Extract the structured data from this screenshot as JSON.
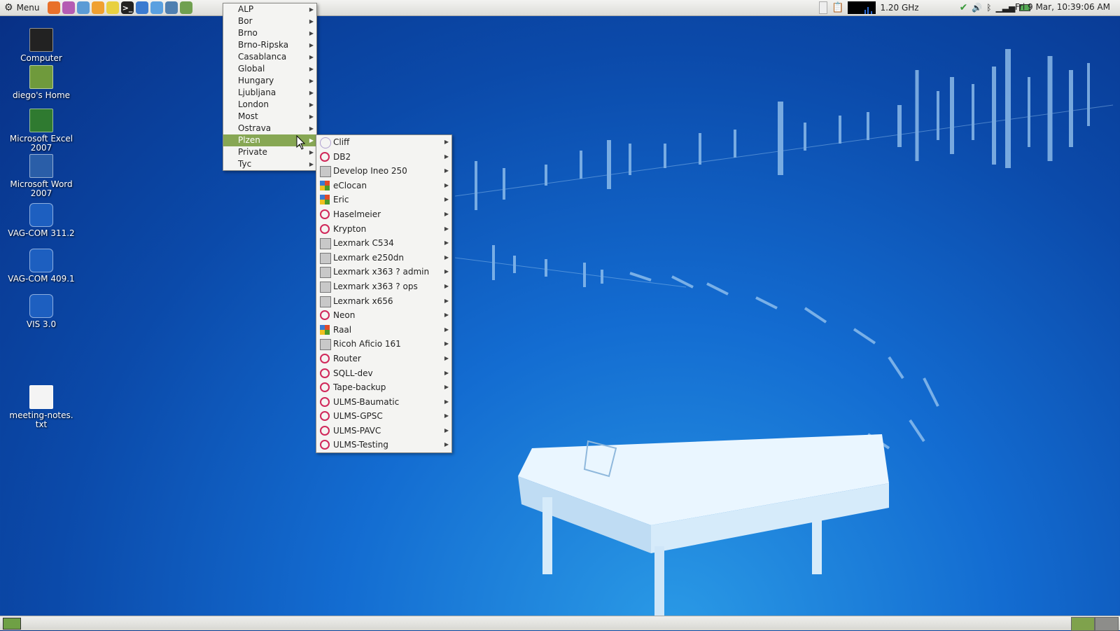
{
  "top_panel": {
    "menu_label": "Menu",
    "launchers": [
      {
        "icon": "firefox-icon",
        "color": "#e8702a"
      },
      {
        "icon": "music-player-icon",
        "color": "#b45cb3"
      },
      {
        "icon": "chat-client-icon",
        "color": "#5b9bd5"
      },
      {
        "icon": "browser-icon",
        "color": "#f0a030"
      },
      {
        "icon": "notes-icon",
        "color": "#e8d040"
      },
      {
        "icon": "terminal-icon",
        "color": "#222222"
      },
      {
        "icon": "network-icon",
        "color": "#3a7ad0"
      },
      {
        "icon": "document-viewer-icon",
        "color": "#5aa0e0"
      },
      {
        "icon": "remote-desktop-icon",
        "color": "#4f7fb0"
      },
      {
        "icon": "system-monitor-icon",
        "color": "#70a050"
      }
    ],
    "cpu_freq": "1.20 GHz",
    "clock": "Fri  9 Mar, 10:39:06 AM"
  },
  "desktop_icons": [
    {
      "label": "Computer",
      "icon": "computer-icon"
    },
    {
      "label": "diego's Home",
      "icon": "home-folder-icon"
    },
    {
      "label": "Microsoft Excel\n2007",
      "icon": "excel-icon"
    },
    {
      "label": "Microsoft Word\n2007",
      "icon": "word-icon"
    },
    {
      "label": "VAG-COM 311.2",
      "icon": "vag-com-icon"
    },
    {
      "label": "VAG-COM 409.1",
      "icon": "vag-com-icon"
    },
    {
      "label": "VIS 3.0",
      "icon": "vis-icon"
    },
    {
      "label": "meeting-notes.\ntxt",
      "icon": "text-file-icon"
    }
  ],
  "menu": {
    "items": [
      "ALP",
      "Bor",
      "Brno",
      "Brno-Ripska",
      "Casablanca",
      "Global",
      "Hungary",
      "Ljubljana",
      "London",
      "Most",
      "Ostrava",
      "Plzen",
      "Private",
      "Tyc"
    ],
    "active": "Plzen"
  },
  "submenu": {
    "items": [
      {
        "label": "Cliff",
        "icon": "generic-host-icon"
      },
      {
        "label": "DB2",
        "icon": "debian-icon"
      },
      {
        "label": "Develop Ineo 250",
        "icon": "printer-icon"
      },
      {
        "label": "eClocan",
        "icon": "windows-icon"
      },
      {
        "label": "Eric",
        "icon": "windows-icon"
      },
      {
        "label": "Haselmeier",
        "icon": "debian-icon"
      },
      {
        "label": "Krypton",
        "icon": "debian-icon"
      },
      {
        "label": "Lexmark C534",
        "icon": "printer-icon"
      },
      {
        "label": "Lexmark e250dn",
        "icon": "printer-icon"
      },
      {
        "label": "Lexmark x363 ? admin",
        "icon": "printer-icon"
      },
      {
        "label": "Lexmark x363 ? ops",
        "icon": "printer-icon"
      },
      {
        "label": "Lexmark x656",
        "icon": "printer-icon"
      },
      {
        "label": "Neon",
        "icon": "debian-icon"
      },
      {
        "label": "Raal",
        "icon": "windows-icon"
      },
      {
        "label": "Ricoh Aficio 161",
        "icon": "printer-icon"
      },
      {
        "label": "Router",
        "icon": "debian-icon"
      },
      {
        "label": "SQLL-dev",
        "icon": "debian-icon"
      },
      {
        "label": "Tape-backup",
        "icon": "debian-icon"
      },
      {
        "label": "ULMS-Baumatic",
        "icon": "debian-icon"
      },
      {
        "label": "ULMS-GPSC",
        "icon": "debian-icon"
      },
      {
        "label": "ULMS-PAVC",
        "icon": "debian-icon"
      },
      {
        "label": "ULMS-Testing",
        "icon": "debian-icon"
      }
    ]
  },
  "colors": {
    "menu_highlight": "#87a754",
    "panel_bg": "#dcdcd8",
    "desktop_bg": "#0b4aaa"
  }
}
